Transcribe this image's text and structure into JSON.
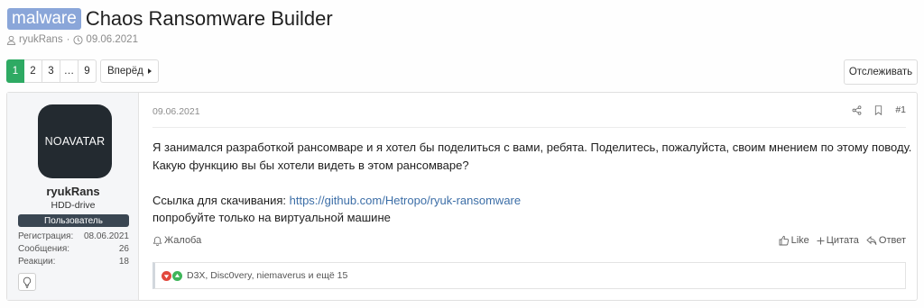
{
  "thread": {
    "prefix": "malware",
    "title": "Chaos Ransomware Builder",
    "author": "ryukRans",
    "sep": "·",
    "date": "09.06.2021"
  },
  "pagination": {
    "pages": [
      "1",
      "2",
      "3",
      "…",
      "9"
    ],
    "current": "1",
    "next_label": "Вперёд"
  },
  "watch_label": "Отслеживать",
  "post": {
    "date": "09.06.2021",
    "number": "#1",
    "user": {
      "avatar_text_no": "NO",
      "avatar_text_avatar": "AVATAR",
      "name": "ryukRans",
      "title": "HDD-drive",
      "role": "Пользователь",
      "stats": [
        {
          "label": "Регистрация:",
          "value": "08.06.2021"
        },
        {
          "label": "Сообщения:",
          "value": "26"
        },
        {
          "label": "Реакции:",
          "value": "18"
        }
      ]
    },
    "body": {
      "line1": "Я занимался разработкой рансомваре и я хотел бы поделиться с вами, ребята. Поделитесь, пожалуйста, своим мнением по этому поводу.",
      "line2": "Какую функцию вы бы хотели видеть в этом рансомваре?",
      "link_prefix": "Ссылка для скачивания: ",
      "link_text": "https://github.com/Hetropo/ryuk-ransomware",
      "line4": "попробуйте только на виртуальной машине"
    },
    "actions": {
      "report": "Жалоба",
      "like": "Like",
      "quote": "Цитата",
      "reply": "Ответ"
    },
    "reactions_text": "D3X, Disc0very, niemaverus и ещё 15"
  },
  "colors": {
    "prefix_bg": "#8aa6d9",
    "active_page": "#2eaa63",
    "link": "#3c6ea7",
    "role_bg": "#3a4652"
  }
}
